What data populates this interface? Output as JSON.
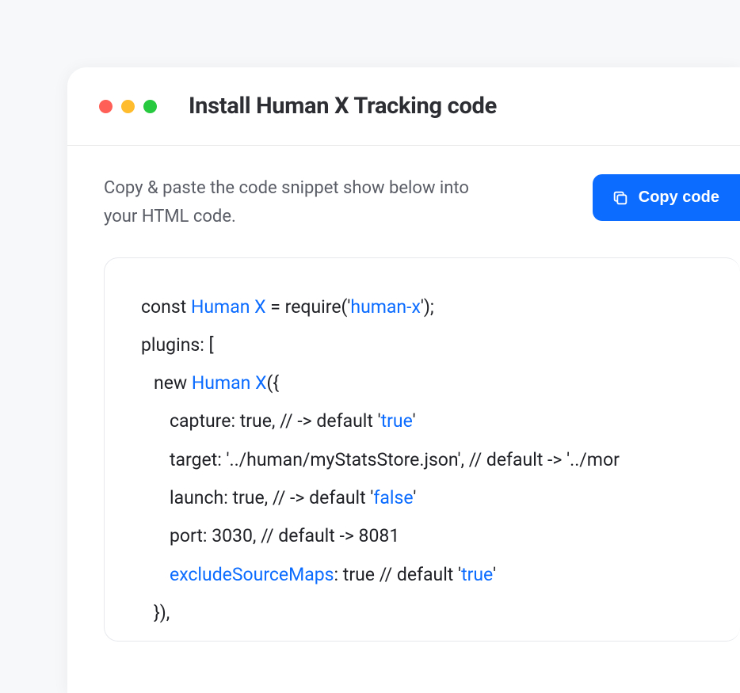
{
  "window": {
    "title": "Install Human X Tracking code"
  },
  "instruction": {
    "text": "Copy & paste the code snippet show below into your HTML code."
  },
  "copy_button": {
    "label": "Copy code"
  },
  "code": {
    "line1_a": "const ",
    "line1_b": "Human X",
    "line1_c": " = require('",
    "line1_d": "human-x",
    "line1_e": "');",
    "line2": "plugins: [",
    "line3_a": "new ",
    "line3_b": "Human X",
    "line3_c": "({",
    "line4_a": "capture: true, // -> default '",
    "line4_b": "true",
    "line4_c": "'",
    "line5": "target: '../human/myStatsStore.json', // default -> '../mor",
    "line6_a": "launch: true, // -> default '",
    "line6_b": "false",
    "line6_c": "'",
    "line7": "port: 3030, // default -> 8081",
    "line8_a": "excludeSourceMaps",
    "line8_b": ": true // default '",
    "line8_c": "true",
    "line8_d": "'",
    "line9": "}),"
  }
}
